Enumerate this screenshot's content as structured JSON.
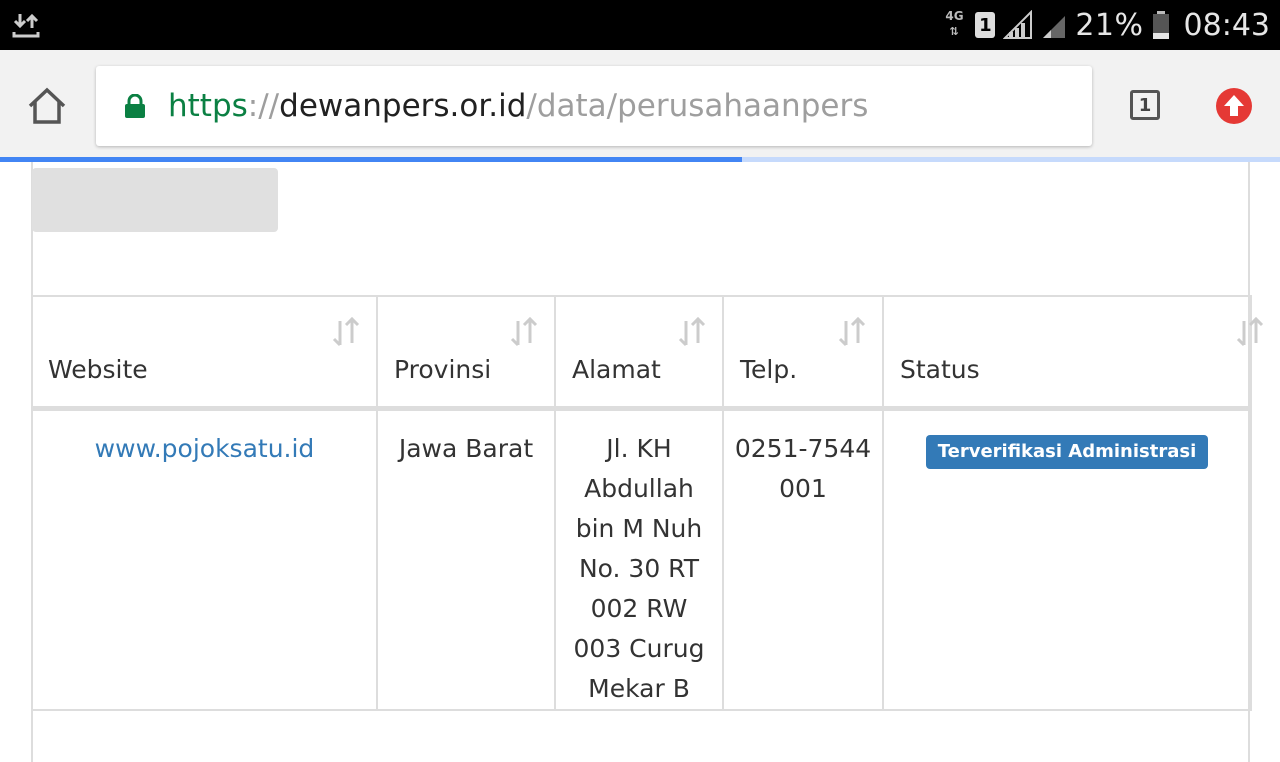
{
  "status_bar": {
    "network_type": "4G",
    "sim_slot": "1",
    "battery_percent": "21%",
    "time": "08:43"
  },
  "browser": {
    "url_scheme": "https",
    "url_separator": "://",
    "url_host": "dewanpers.or.id",
    "url_path": "/data/perusahaanpers",
    "tab_count": "1",
    "load_progress": 0.58,
    "secure": true
  },
  "table": {
    "columns": [
      {
        "label": "Website"
      },
      {
        "label": "Provinsi"
      },
      {
        "label": "Alamat"
      },
      {
        "label": "Telp."
      },
      {
        "label": "Status"
      }
    ],
    "rows": [
      {
        "website": "www.pojoksatu.id",
        "provinsi": "Jawa Barat",
        "alamat": "Jl. KH Abdullah bin M Nuh No. 30 RT 002 RW 003 Curug Mekar B",
        "telp": "0251-7544001",
        "status": "Terverifikasi Administrasi"
      }
    ]
  },
  "colors": {
    "secure_green": "#0b8043",
    "link_blue": "#337ab7",
    "badge_blue": "#337ab7",
    "progress_blue": "#4285f4",
    "update_red": "#e53935"
  },
  "icons": {
    "status_left": "download-icon",
    "home": "home-icon",
    "lock": "lock-icon",
    "sort": "sort-icon",
    "update": "update-arrow-icon"
  }
}
